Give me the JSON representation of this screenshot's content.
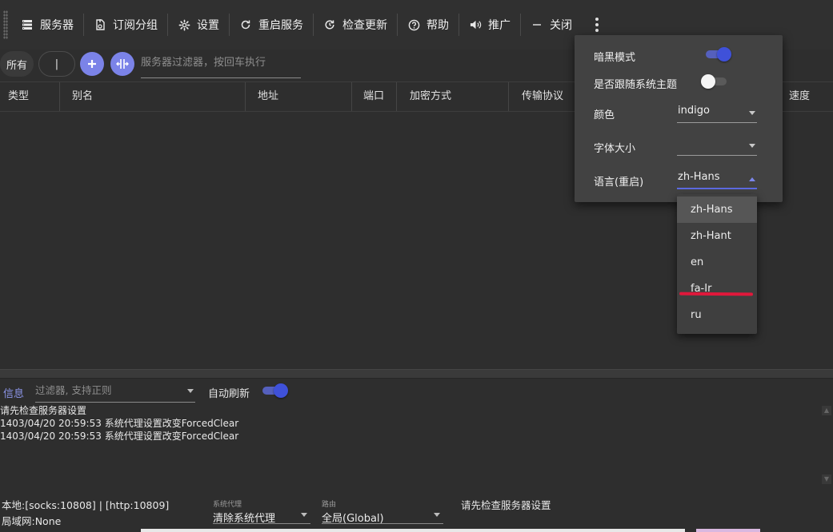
{
  "toolbar": {
    "servers": "服务器",
    "sub_group": "订阅分组",
    "settings": "设置",
    "restart": "重启服务",
    "check_update": "检查更新",
    "help": "帮助",
    "promote": "推广",
    "close": "关闭"
  },
  "filter_bar": {
    "all_chip": "所有",
    "separator_chip": "|",
    "filter_placeholder": "服务器过滤器，按回车执行"
  },
  "table": {
    "columns": [
      "类型",
      "别名",
      "地址",
      "端口",
      "加密方式",
      "传输协议",
      "速度(M/s)"
    ]
  },
  "settings_popup": {
    "dark_mode": {
      "label": "暗黑模式",
      "on": true
    },
    "follow_system": {
      "label": "是否跟随系统主题",
      "on": false
    },
    "color": {
      "label": "颜色",
      "value": "indigo"
    },
    "font_size": {
      "label": "字体大小",
      "value": ""
    },
    "language": {
      "label": "语言(重启)",
      "value": "zh-Hans"
    }
  },
  "language_options": [
    "zh-Hans",
    "zh-Hant",
    "en",
    "fa-Ir",
    "ru"
  ],
  "log_panel": {
    "tab": "信息",
    "filter_placeholder": "过滤器, 支持正则",
    "auto_refresh_label": "自动刷新",
    "auto_refresh_on": true,
    "lines": [
      "请先检查服务器设置",
      "1403/04/20 20:59:53 系统代理设置改变ForcedClear",
      "1403/04/20 20:59:53 系统代理设置改变ForcedClear"
    ]
  },
  "status_bar": {
    "local_ports": "本地:[socks:10808] | [http:10809]",
    "lan": "局域网:None",
    "system_proxy_label": "系统代理",
    "system_proxy_value": "清除系统代理",
    "routing_label": "路由",
    "routing_value": "全局(Global)",
    "message": "请先检查服务器设置"
  },
  "colors": {
    "accent": "#5c6ae0",
    "button_accent": "#7b83e8",
    "background": "#2e2e2e",
    "popup": "#424242",
    "annotation_red": "#e0183b"
  }
}
